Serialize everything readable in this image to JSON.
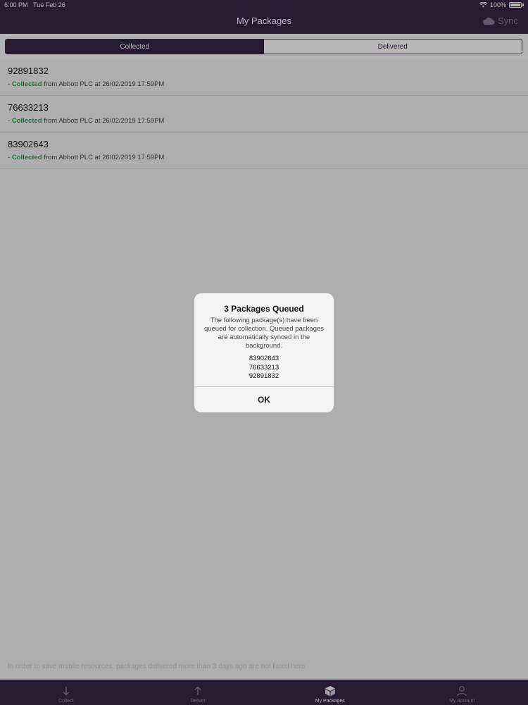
{
  "status_bar": {
    "time": "6:00 PM",
    "date": "Tue Feb 26",
    "battery": "100%",
    "wifi_icon": "wifi-icon"
  },
  "nav": {
    "title": "My Packages",
    "sync_label": "Sync",
    "sync_icon": "cloud-icon"
  },
  "segments": [
    {
      "label": "Collected",
      "selected": true
    },
    {
      "label": "Delivered",
      "selected": false
    }
  ],
  "packages": [
    {
      "id": "92891832",
      "dash": "- ",
      "status": "Collected",
      "detail": " from Abbott PLC at 26/02/2019 17:59PM"
    },
    {
      "id": "76633213",
      "dash": "- ",
      "status": "Collected",
      "detail": " from Abbott PLC at 26/02/2019 17:59PM"
    },
    {
      "id": "83902643",
      "dash": "- ",
      "status": "Collected",
      "detail": " from Abbott PLC at 26/02/2019 17:59PM"
    }
  ],
  "footer_note": "In order to save mobile resources, packages delivered more than 3 days ago are not listed here",
  "tabs": [
    {
      "label": "Collect",
      "icon": "arrow-down-icon",
      "active": false
    },
    {
      "label": "Deliver",
      "icon": "arrow-up-icon",
      "active": false
    },
    {
      "label": "My Packages",
      "icon": "package-box-icon",
      "active": true
    },
    {
      "label": "My Account",
      "icon": "user-icon",
      "active": false
    }
  ],
  "alert": {
    "title": "3 Packages Queued",
    "message": "The following package(s) have been queued for collection. Queued packages are automatically synced in the background.",
    "ids": [
      "83902643",
      "76633213",
      "92891832"
    ],
    "ok_label": "OK"
  },
  "colors": {
    "brand": "#3a2547",
    "collected_status": "#2e9e44"
  }
}
